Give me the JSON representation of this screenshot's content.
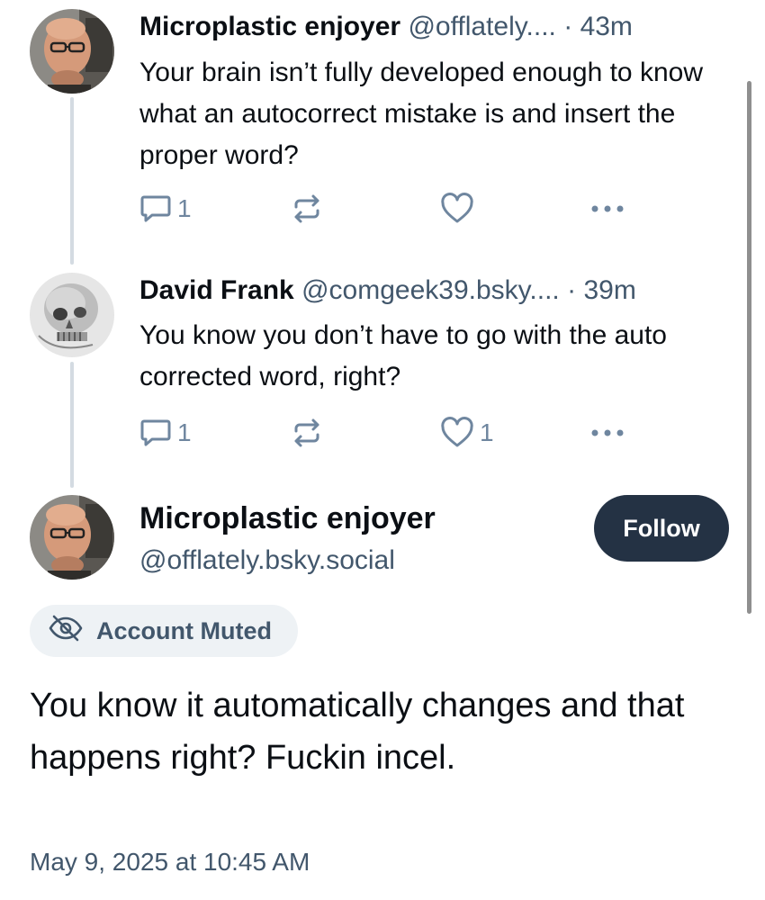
{
  "thread": [
    {
      "author_name": "Microplastic enjoyer",
      "author_handle": "@offlately....",
      "separator": "·",
      "time_ago": "43m",
      "text": "Your brain isn’t fully developed enough to know what an autocorrect mistake is and insert the proper word?",
      "reply_count": "1",
      "repost_count": "",
      "like_count": "",
      "liked": false,
      "icons": [
        "reply-icon",
        "repost-icon",
        "like-icon",
        "more-icon"
      ]
    },
    {
      "author_name": "David Frank",
      "author_handle": "@comgeek39.bsky....",
      "separator": "·",
      "time_ago": "39m",
      "text": "You know you don’t have to go with the auto corrected word, right?",
      "reply_count": "1",
      "repost_count": "",
      "like_count": "1",
      "liked": false,
      "icons": [
        "reply-icon",
        "repost-icon",
        "like-icon",
        "more-icon"
      ]
    }
  ],
  "main_post": {
    "author_name": "Microplastic enjoyer",
    "author_handle": "@offlately.bsky.social",
    "follow_label": "Follow",
    "muted_label": "Account Muted",
    "muted_icon": "eye-slash-icon",
    "text": "You know it automatically changes and that happens right? Fuckin incel.",
    "timestamp": "May 9, 2025 at 10:45 AM"
  },
  "colors": {
    "text_primary": "#0b0f14",
    "text_secondary": "#42576c",
    "icon_gray": "#6f869f",
    "thread_line": "#d4dbe2",
    "follow_button_bg": "#243244",
    "muted_pill_bg": "#eef2f5"
  }
}
